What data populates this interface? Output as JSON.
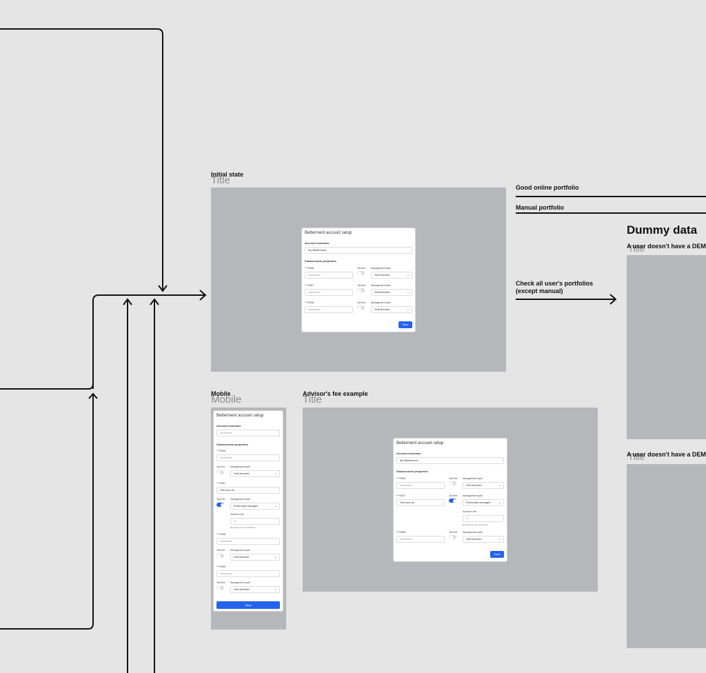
{
  "sections": {
    "good_online": "Good online portfolio",
    "manual": "Manual portfolio",
    "check_all": "Check all user's portfolios (except manual)",
    "dummy_heading": "Dummy data",
    "no_dem_1": "A user doesn't have a DEM",
    "no_dem_2": "A user doesn't have a DEM"
  },
  "frames": {
    "initial": {
      "label": "Initial state",
      "title": "Title"
    },
    "mobile": {
      "label": "Mobile",
      "title": "Mobile"
    },
    "advisor": {
      "label": "Advisor's fee example",
      "title": "Title"
    },
    "dummy1": {
      "title": "Title"
    },
    "dummy2": {
      "title": "Title"
    }
  },
  "form": {
    "title": "Betterment account setup",
    "nickname_label": "Account nickname",
    "nickname_value": "My Betterment",
    "nickname_placeholder": "Nickname",
    "subaccounts_label": "Subaccounts properties",
    "tax_free_label": "Tax free",
    "management_label": "Management style",
    "self_directed": "Self-directed",
    "externally_managed": "Externally managed",
    "advisor_fee_label": "Advisor's fee",
    "advisor_fee_placeholder": "%",
    "advisor_fee_hint": "Required for the verification",
    "sub_acct_2": "Sub acct #2",
    "save": "Save",
    "accounts": [
      "****5256",
      "****5257",
      "****5258",
      "****5259"
    ]
  },
  "colors": {
    "background": "#e5e5e5",
    "frame": "#b6b7ba",
    "accent": "#2563eb",
    "wire": "#111111"
  }
}
